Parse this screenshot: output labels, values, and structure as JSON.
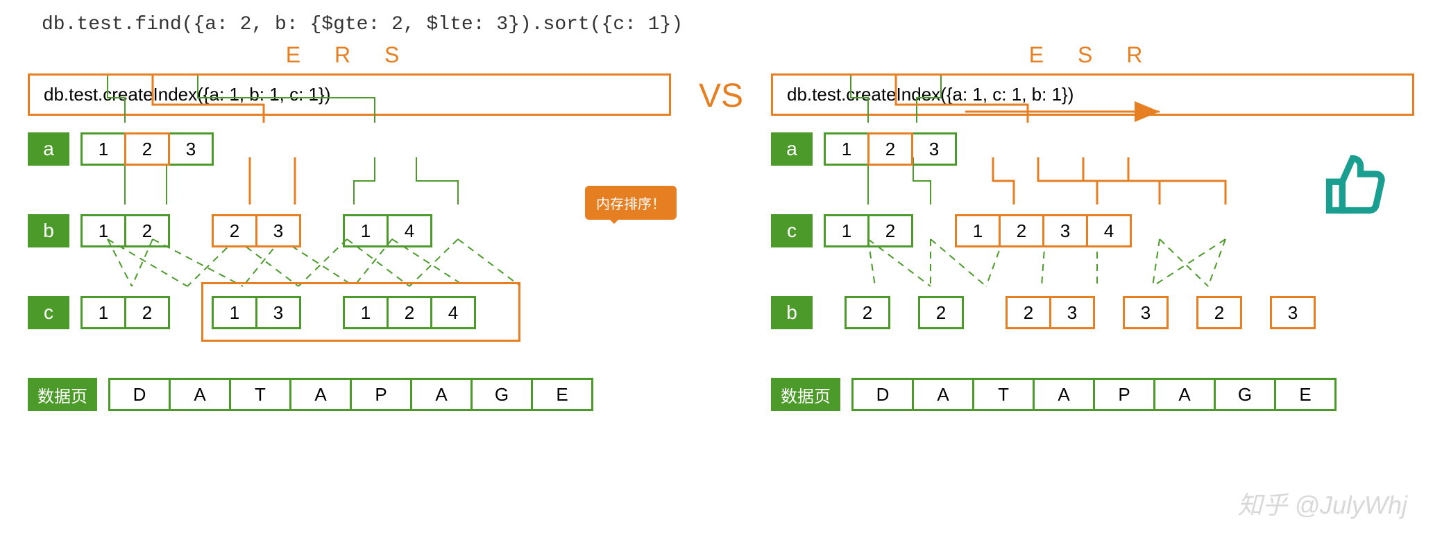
{
  "query": "db.test.find({a: 2, b: {$gte: 2, $lte: 3}).sort({c: 1})",
  "vs_label": "VS",
  "watermark": "知乎 @JulyWhj",
  "left": {
    "title": "E  R  S",
    "index_stmt": "db.test.createIndex({a: 1, b: 1, c: 1})",
    "callout": "内存排序！",
    "levels": {
      "a": {
        "key": "a",
        "groups": [
          [
            "1",
            "2",
            "3"
          ]
        ],
        "highlight": [
          [
            1
          ]
        ]
      },
      "b": {
        "key": "b",
        "groups": [
          [
            "1",
            "2"
          ],
          [
            "2",
            "3"
          ],
          [
            "1",
            "4"
          ]
        ],
        "highlight_group": 1
      },
      "c": {
        "key": "c",
        "groups": [
          [
            "1",
            "2"
          ],
          [
            "1",
            "3"
          ],
          [
            "1",
            "2",
            "4"
          ]
        ],
        "highlight_groups": [
          1,
          2
        ]
      },
      "data": {
        "key": "数据页",
        "cells": [
          "D",
          "A",
          "T",
          "A",
          "P",
          "A",
          "G",
          "E"
        ]
      }
    }
  },
  "right": {
    "title": "E  S  R",
    "index_stmt": "db.test.createIndex({a: 1, c: 1, b: 1})",
    "levels": {
      "a": {
        "key": "a",
        "groups": [
          [
            "1",
            "2",
            "3"
          ]
        ],
        "highlight": [
          [
            1
          ]
        ]
      },
      "c": {
        "key": "c",
        "groups": [
          [
            "1",
            "2"
          ],
          [
            "1",
            "2",
            "3",
            "4"
          ]
        ],
        "highlight_group": 1
      },
      "b": {
        "key": "b",
        "groups": [
          [
            "2"
          ],
          [
            "2"
          ],
          [
            "2",
            "3"
          ],
          [
            "3"
          ],
          [
            "2"
          ],
          [
            "3"
          ]
        ],
        "highlight_from": 2
      },
      "data": {
        "key": "数据页",
        "cells": [
          "D",
          "A",
          "T",
          "A",
          "P",
          "A",
          "G",
          "E"
        ]
      }
    }
  }
}
